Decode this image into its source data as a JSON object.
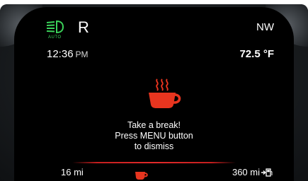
{
  "cluster": {
    "gear": "R",
    "compass": "NW",
    "headlight": {
      "icon": "auto-headlight-icon",
      "label": "AUTO",
      "color": "#3bd35a"
    },
    "time": "12:36",
    "time_period": "PM",
    "temperature": "72.5 °F"
  },
  "alert": {
    "icon": "coffee-cup-icon",
    "color": "#e8351f",
    "lines": [
      "Take a break!",
      "Press MENU button",
      "to dismiss"
    ]
  },
  "footer": {
    "left_distance": "16 mi",
    "center_icon": "coffee-cup-icon",
    "right_distance": "360 mi",
    "right_icon": "fuel-pump-icon",
    "divider_color": "#e22a2a"
  }
}
